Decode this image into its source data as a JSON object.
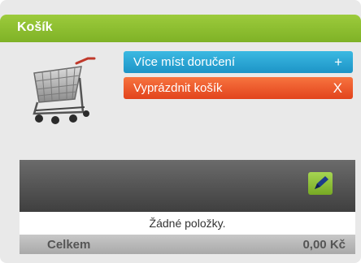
{
  "cart": {
    "title": "Košík",
    "actions": {
      "multi_delivery": {
        "label": "Více míst doručení",
        "glyph": "+",
        "icon": "plus-icon",
        "color": "#2aa6d6"
      },
      "empty_cart": {
        "label": "Vyprázdnit košík",
        "glyph": "X",
        "icon": "close-icon",
        "color": "#ef5a2a"
      }
    },
    "empty_message": "Žádné položky.",
    "total_label": "Celkem",
    "total_value": "0,00 Kč",
    "colors": {
      "header": "#8cc137",
      "edit_button": "#8dc43b"
    }
  }
}
